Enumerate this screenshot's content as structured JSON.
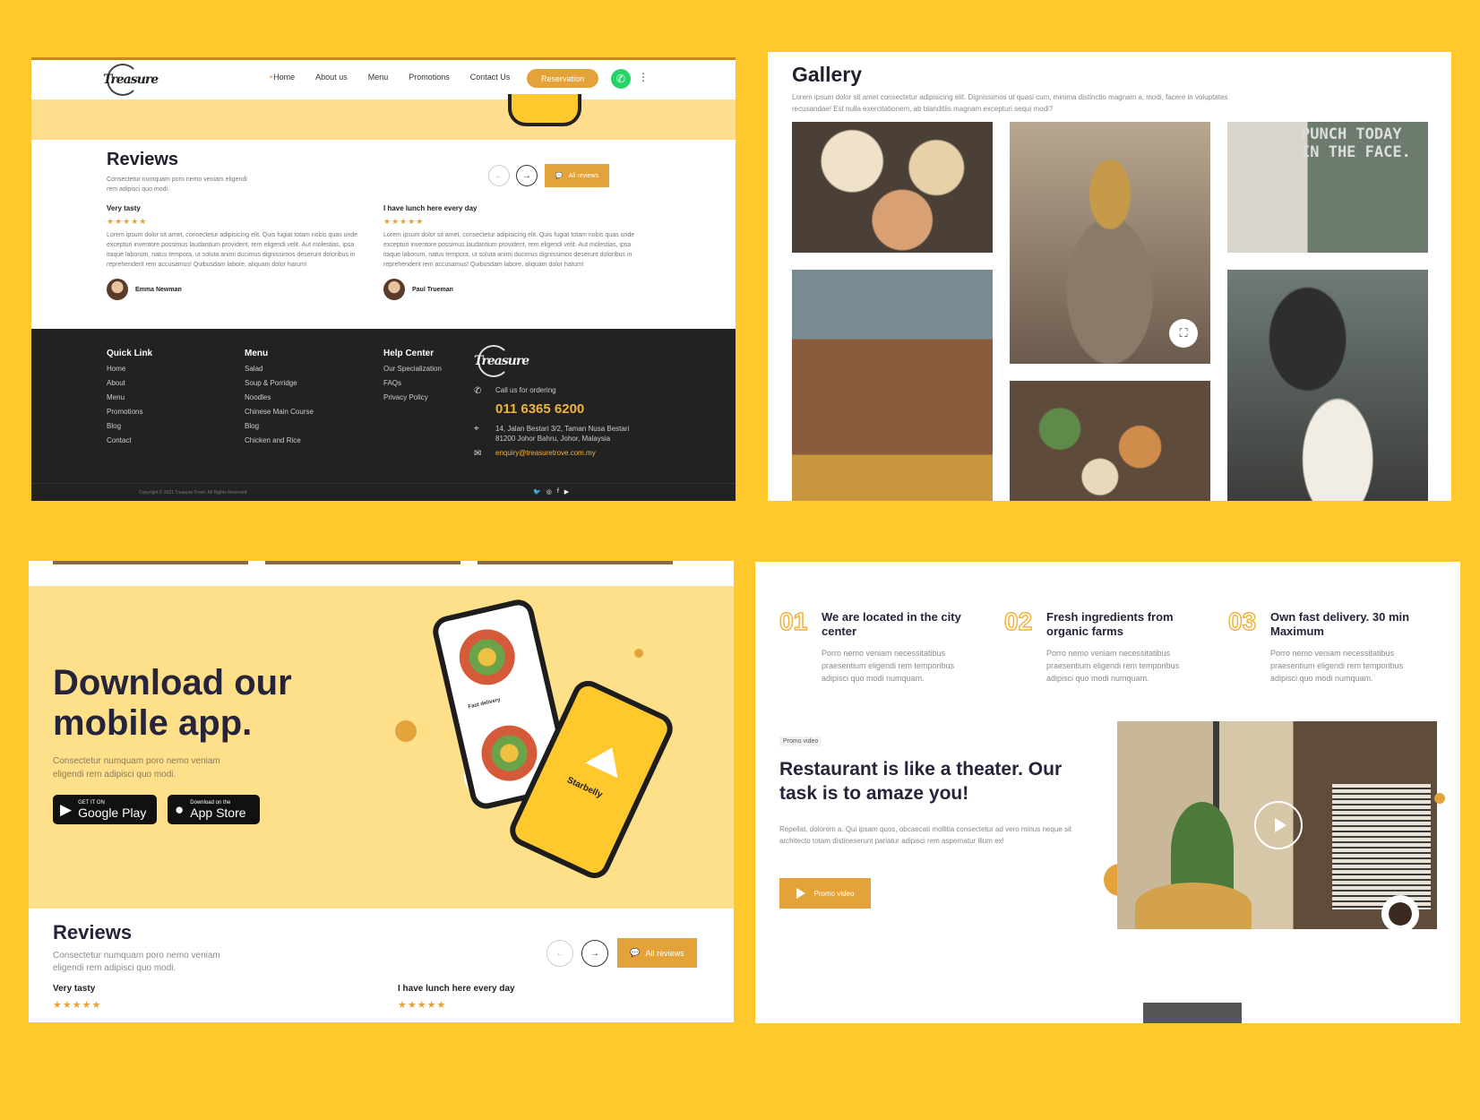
{
  "panel1": {
    "logo_text": "Treasure",
    "nav": [
      "Home",
      "About us",
      "Menu",
      "Promotions",
      "Contact Us"
    ],
    "reservation_label": "Reservation",
    "reviews": {
      "title": "Reviews",
      "subtitle": "Consectetur numquam poro nemo veniam eligendi rem adipisci quo modi.",
      "all_reviews_label": "All reviews",
      "items": [
        {
          "title": "Very tasty",
          "stars": "★★★★★",
          "body": "Lorem ipsum dolor sit amet, consectetur adipisicing elit. Quis fugiat totam nobis quas unde excepturi inventore possimus laudantium provident, rem eligendi velit. Aut molestias, ipsa itaque laborum, natus tempora, ut soluta animi ducimus dignissimos deserunt doloribus in reprehenderit rem accusamus! Quibusdam labore, aliquam dolor harum!",
          "author": "Emma Newman"
        },
        {
          "title": "I have lunch here every day",
          "stars": "★★★★★",
          "body": "Lorem ipsum dolor sit amet, consectetur adipisicing elit. Quis fugiat totam nobis quas unde excepturi inventore possimus laudantium provident, rem eligendi velit. Aut molestias, ipsa itaque laborum, natus tempora, ut soluta animi ducimus dignissimos deserunt doloribus in reprehenderit rem accusamus! Quibusdam labore, aliquam dolor harum!",
          "author": "Paul Trueman"
        }
      ]
    },
    "footer": {
      "quick_link": {
        "title": "Quick Link",
        "items": [
          "Home",
          "About",
          "Menu",
          "Promotions",
          "Blog",
          "Contact"
        ]
      },
      "menu": {
        "title": "Menu",
        "items": [
          "Salad",
          "Soup & Porridge",
          "Noodles",
          "Chinese Main Course",
          "Blog",
          "Chicken and Rice"
        ]
      },
      "help": {
        "title": "Help Center",
        "items": [
          "Our Specialization",
          "FAQs",
          "Privacy Policy"
        ]
      },
      "call_label": "Call us for ordering",
      "phone": "011 6365 6200",
      "address": "14, Jalan Bestari 3/2, Taman Nusa Bestari 81200 Johor Bahru, Johor, Malaysia",
      "email": "enquiry@treasuretrove.com.my",
      "copyright": "Copyright © 2021 Treasure Trove. All Rights Reserved"
    }
  },
  "panel2": {
    "title": "Gallery",
    "subtitle": "Lorem ipsum dolor sit amet consectetur adipisicing elit. Dignissimos ut quasi cum, minima distinctio magnam a, modi, facere in voluptates recusandae! Est nulla exercitationem, ab blanditiis magnam excepturi sequi modi?",
    "sign_text": "PUNCH TODAY IN THE FACE."
  },
  "panel3": {
    "title": "Download our mobile app.",
    "subtitle": "Consectetur numquam poro nemo veniam eligendi rem adipisci quo modi.",
    "google": {
      "small": "GET IT ON",
      "big": "Google Play"
    },
    "apple": {
      "small": "Download on the",
      "big": "App Store"
    },
    "phone_screen_label": "Fast delivery",
    "phone_brand": "Starbelly",
    "reviews": {
      "title": "Reviews",
      "subtitle": "Consectetur numquam poro nemo veniam eligendi rem adipisci quo modi.",
      "all_reviews_label": "All reviews",
      "items": [
        {
          "title": "Very tasty",
          "stars": "★★★★★"
        },
        {
          "title": "I have lunch here every day",
          "stars": "★★★★★"
        }
      ]
    }
  },
  "panel4": {
    "features": [
      {
        "num": "01",
        "title": "We are located in the city center",
        "desc": "Porro nemo veniam necessitatibus praesentium eligendi rem temporibus adipisci quo modi numquam."
      },
      {
        "num": "02",
        "title": "Fresh ingredients from organic farms",
        "desc": "Porro nemo veniam necessitatibus praesentium eligendi rem temporibus adipisci quo modi numquam."
      },
      {
        "num": "03",
        "title": "Own fast delivery. 30 min Maximum",
        "desc": "Porro nemo veniam necessitatibus praesentium eligendi rem temporibus adipisci quo modi numquam."
      }
    ],
    "tag": "Promo video",
    "title": "Restaurant is like a theater. Our task is to amaze you!",
    "desc": "Repellat, dolorem a. Qui ipsam quos, obcaecati mollitia consectetur ad vero minus neque sit architecto totam distineserunt pariatur adipisci rem aspernatur illum ex!",
    "button_label": "Promo video"
  },
  "colors": {
    "background": "#FFC92E",
    "accent": "#E3A33A",
    "footer": "#222222",
    "whatsapp": "#25D366"
  }
}
